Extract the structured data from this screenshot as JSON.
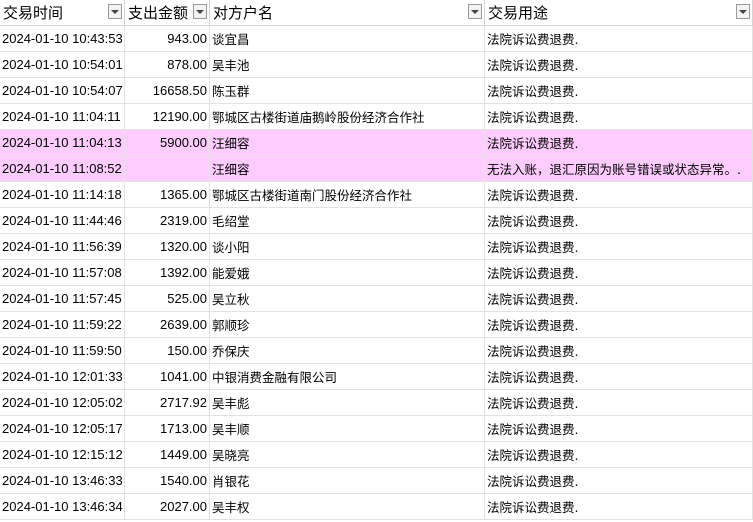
{
  "headers": {
    "time": "交易时间",
    "amount": "支出金额",
    "counterparty": "对方户名",
    "purpose": "交易用途"
  },
  "colors": {
    "highlight": "#ffccff",
    "grid": "#e2e2e2"
  },
  "icons": {
    "filter": "filter-dropdown-icon"
  },
  "rows": [
    {
      "time": "2024-01-10 10:43:53",
      "amount": "943.00",
      "name": "谈宜昌",
      "purpose": "法院诉讼费退费.",
      "highlight": false
    },
    {
      "time": "2024-01-10 10:54:01",
      "amount": "878.00",
      "name": "吴丰池",
      "purpose": "法院诉讼费退费.",
      "highlight": false
    },
    {
      "time": "2024-01-10 10:54:07",
      "amount": "16658.50",
      "name": "陈玉群",
      "purpose": "法院诉讼费退费.",
      "highlight": false
    },
    {
      "time": "2024-01-10 11:04:11",
      "amount": "12190.00",
      "name": "鄂城区古楼街道庙鹅岭股份经济合作社",
      "purpose": "法院诉讼费退费.",
      "highlight": false
    },
    {
      "time": "2024-01-10 11:04:13",
      "amount": "5900.00",
      "name": "汪细容",
      "purpose": "法院诉讼费退费.",
      "highlight": true
    },
    {
      "time": "2024-01-10 11:08:52",
      "amount": "",
      "name": "汪细容",
      "purpose": "无法入账，退汇原因为账号错误或状态异常。.",
      "highlight": true
    },
    {
      "time": "2024-01-10 11:14:18",
      "amount": "1365.00",
      "name": "鄂城区古楼街道南门股份经济合作社",
      "purpose": "法院诉讼费退费.",
      "highlight": false
    },
    {
      "time": "2024-01-10 11:44:46",
      "amount": "2319.00",
      "name": "毛绍堂",
      "purpose": "法院诉讼费退费.",
      "highlight": false
    },
    {
      "time": "2024-01-10 11:56:39",
      "amount": "1320.00",
      "name": "谈小阳",
      "purpose": "法院诉讼费退费.",
      "highlight": false
    },
    {
      "time": "2024-01-10 11:57:08",
      "amount": "1392.00",
      "name": "能爱娥",
      "purpose": "法院诉讼费退费.",
      "highlight": false
    },
    {
      "time": "2024-01-10 11:57:45",
      "amount": "525.00",
      "name": "吴立秋",
      "purpose": "法院诉讼费退费.",
      "highlight": false
    },
    {
      "time": "2024-01-10 11:59:22",
      "amount": "2639.00",
      "name": "郭顺珍",
      "purpose": "法院诉讼费退费.",
      "highlight": false
    },
    {
      "time": "2024-01-10 11:59:50",
      "amount": "150.00",
      "name": "乔保庆",
      "purpose": "法院诉讼费退费.",
      "highlight": false
    },
    {
      "time": "2024-01-10 12:01:33",
      "amount": "1041.00",
      "name": "中银消费金融有限公司",
      "purpose": "法院诉讼费退费.",
      "highlight": false
    },
    {
      "time": "2024-01-10 12:05:02",
      "amount": "2717.92",
      "name": "吴丰彪",
      "purpose": "法院诉讼费退费.",
      "highlight": false
    },
    {
      "time": "2024-01-10 12:05:17",
      "amount": "1713.00",
      "name": "吴丰顺",
      "purpose": "法院诉讼费退费.",
      "highlight": false
    },
    {
      "time": "2024-01-10 12:15:12",
      "amount": "1449.00",
      "name": "吴晓亮",
      "purpose": "法院诉讼费退费.",
      "highlight": false
    },
    {
      "time": "2024-01-10 13:46:33",
      "amount": "1540.00",
      "name": "肖银花",
      "purpose": "法院诉讼费退费.",
      "highlight": false
    },
    {
      "time": "2024-01-10 13:46:34",
      "amount": "2027.00",
      "name": "吴丰权",
      "purpose": "法院诉讼费退费.",
      "highlight": false
    }
  ]
}
